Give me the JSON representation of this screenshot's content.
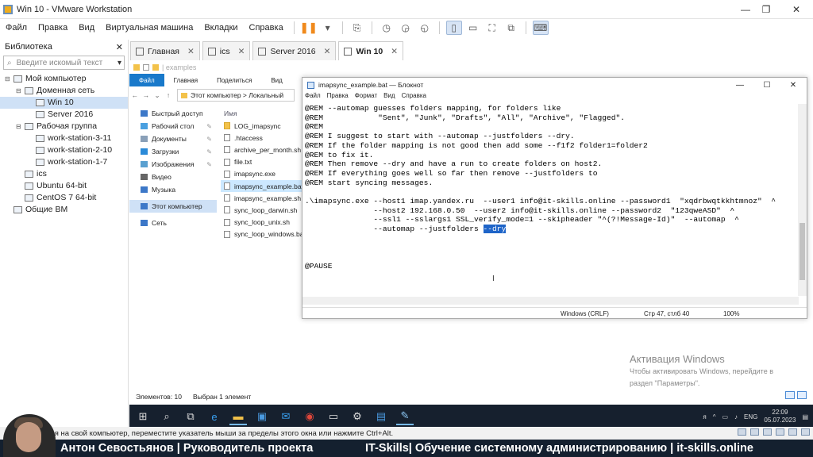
{
  "window": {
    "title": "Win 10 - VMware Workstation"
  },
  "menu": [
    "Файл",
    "Правка",
    "Вид",
    "Виртуальная машина",
    "Вкладки",
    "Справка"
  ],
  "library": {
    "title": "Библиотека",
    "search_placeholder": "Введите искомый текст",
    "tree": [
      {
        "label": "Мой компьютер",
        "level": 0,
        "expander": "⊟"
      },
      {
        "label": "Доменная сеть",
        "level": 1,
        "expander": "⊟"
      },
      {
        "label": "Win 10",
        "level": 2,
        "selected": true
      },
      {
        "label": "Server 2016",
        "level": 2
      },
      {
        "label": "Рабочая группа",
        "level": 1,
        "expander": "⊟"
      },
      {
        "label": "work-station-3-11",
        "level": 2
      },
      {
        "label": "work-station-2-10",
        "level": 2
      },
      {
        "label": "work-station-1-7",
        "level": 2
      },
      {
        "label": "ics",
        "level": 1
      },
      {
        "label": "Ubuntu 64-bit",
        "level": 1
      },
      {
        "label": "CentOS 7 64-bit",
        "level": 1
      },
      {
        "label": "Общие ВМ",
        "level": 0
      }
    ]
  },
  "tabs": [
    {
      "label": "Главная"
    },
    {
      "label": "ics"
    },
    {
      "label": "Server 2016"
    },
    {
      "label": "Win 10",
      "active": true
    }
  ],
  "explorer": {
    "title": "| examples",
    "ribbon": [
      "Файл",
      "Главная",
      "Поделиться",
      "Вид"
    ],
    "address": "Этот компьютер  >  Локальный",
    "nav": [
      {
        "label": "Быстрый доступ",
        "color": "#3c78c8"
      },
      {
        "label": "Рабочий стол",
        "color": "#4aa0e0",
        "pin": true
      },
      {
        "label": "Документы",
        "color": "#8aa0b8",
        "pin": true
      },
      {
        "label": "Загрузки",
        "color": "#2a8ad8",
        "pin": true
      },
      {
        "label": "Изображения",
        "color": "#5aa0d0",
        "pin": true
      },
      {
        "label": "Видео",
        "color": "#666"
      },
      {
        "label": "Музыка",
        "color": "#3c78c8"
      },
      {
        "label": "Этот компьютер",
        "color": "#3c78c8",
        "selected": true
      },
      {
        "label": "Сеть",
        "color": "#3c78c8"
      }
    ],
    "column_header": "Имя",
    "files": [
      {
        "name": "LOG_imapsync",
        "folder": true
      },
      {
        "name": ".htaccess"
      },
      {
        "name": "archive_per_month.sh"
      },
      {
        "name": "file.txt"
      },
      {
        "name": "imapsync.exe"
      },
      {
        "name": "imapsync_example.bat",
        "selected": true
      },
      {
        "name": "imapsync_example.sh"
      },
      {
        "name": "sync_loop_darwin.sh"
      },
      {
        "name": "sync_loop_unix.sh"
      },
      {
        "name": "sync_loop_windows.bat"
      }
    ],
    "status_count": "Элементов: 10",
    "status_selected": "Выбран 1 элемент"
  },
  "notepad": {
    "title": "imapsync_example.bat — Блокнот",
    "menu": [
      "Файл",
      "Правка",
      "Формат",
      "Вид",
      "Справка"
    ],
    "text_before": "@REM --automap guesses folders mapping, for folders like\n@REM            \"Sent\", \"Junk\", \"Drafts\", \"All\", \"Archive\", \"Flagged\".\n@REM\n@REM I suggest to start with --automap --justfolders --dry.\n@REM If the folder mapping is not good then add some --f1f2 folder1=folder2\n@REM to fix it.\n@REM Then remove --dry and have a run to create folders on host2.\n@REM If everything goes well so far then remove --justfolders to\n@REM start syncing messages.\n\n.\\imapsync.exe --host1 imap.yandex.ru  --user1 info@it-skills.online --password1  \"xqdrbwqtkkhtmnoz\"  ^\n               --host2 192.168.0.50  --user2 info@it-skills.online --password2  \"123qweASD\"  ^\n               --ssl1 --sslargs1 SSL_verify_mode=1 --skipheader \"^(?!Message-Id)\"  --automap  ^\n               --automap --justfolders ",
    "highlighted": "--dry",
    "text_after": "\n\n\n\n@PAUSE",
    "status_eol": "Windows (CRLF)",
    "status_pos": "Стр 47, стлб 40",
    "status_zoom": "100%"
  },
  "activation": {
    "title": "Активация Windows",
    "line1": "Чтобы активировать Windows, перейдите в",
    "line2": "раздел \"Параметры\"."
  },
  "tray": {
    "lang": "ENG",
    "time": "22:09",
    "date": "05.07.2023",
    "ime": "ᴙ"
  },
  "vm_status": "ся на свой компьютер, переместите указатель мыши за пределы этого окна или нажмите Ctrl+Alt.",
  "lower_third": {
    "name": "Антон Севостьянов | Руководитель проекта",
    "right": "IT-Skills| Обучение системному администрированию | it-skills.online"
  }
}
